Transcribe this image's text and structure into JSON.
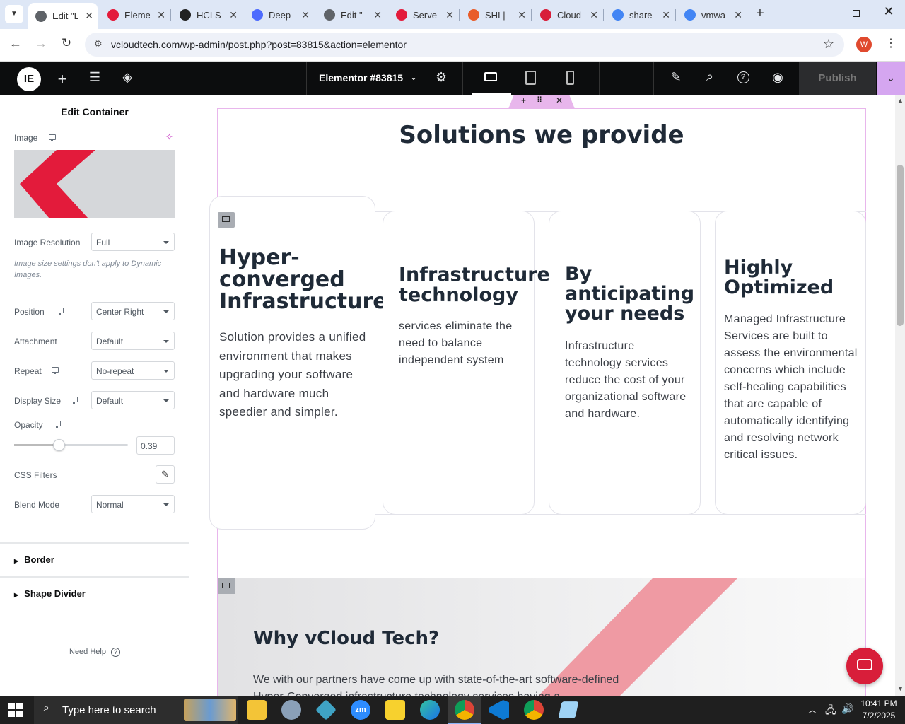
{
  "browser": {
    "tabs": [
      {
        "label": "Edit \"E",
        "active": true,
        "icon": "wordpress-icon"
      },
      {
        "label": "Eleme",
        "icon": "elementor-gem-icon"
      },
      {
        "label": "HCI S",
        "icon": "hci-icon"
      },
      {
        "label": "Deep",
        "icon": "deepseek-icon"
      },
      {
        "label": "Edit \"",
        "icon": "wordpress-icon"
      },
      {
        "label": "Serve",
        "icon": "elementor-gem-icon"
      },
      {
        "label": "SHI |",
        "icon": "shi-icon"
      },
      {
        "label": "Cloud",
        "icon": "cloud-icon"
      },
      {
        "label": "share",
        "icon": "google-icon"
      },
      {
        "label": "vmwa",
        "icon": "google-icon"
      }
    ],
    "url": "vcloudtech.com/wp-admin/post.php?post=83815&action=elementor",
    "profile_initial": "W"
  },
  "editor": {
    "document_title": "Elementor #83815",
    "publish_label": "Publish"
  },
  "panel": {
    "title": "Edit Container",
    "image_label": "Image",
    "image_resolution_label": "Image Resolution",
    "image_resolution_value": "Full",
    "image_note": "Image size settings don't apply to Dynamic Images.",
    "position_label": "Position",
    "position_value": "Center Right",
    "attachment_label": "Attachment",
    "attachment_value": "Default",
    "repeat_label": "Repeat",
    "repeat_value": "No-repeat",
    "display_size_label": "Display Size",
    "display_size_value": "Default",
    "opacity_label": "Opacity",
    "opacity_value": "0.39",
    "opacity_fraction": 0.39,
    "css_filters_label": "CSS Filters",
    "blend_mode_label": "Blend Mode",
    "blend_mode_value": "Normal",
    "border_label": "Border",
    "shape_divider_label": "Shape Divider",
    "need_help_label": "Need Help"
  },
  "page": {
    "section_title": "Solutions we provide",
    "cards": [
      {
        "title": "Hyper-\nconverged\nInfrastructure",
        "text": "Solution provides a unified environment that makes upgrading your software and hardware much speedier and simpler."
      },
      {
        "title": "Infrastructure\ntechnology",
        "text": "services eliminate the need to balance independent system"
      },
      {
        "title": "By\nanticipating\nyour needs",
        "text": "Infrastructure technology services reduce the cost of your organizational software and hardware."
      },
      {
        "title": "Highly\nOptimized",
        "text": "Managed Infrastructure Services are built to assess the environmental concerns which include self-healing capabilities that are capable of automatically identifying and resolving network critical issues."
      }
    ],
    "why_title": "Why vCloud Tech?",
    "why_text": "We with our partners have come up with state-of-the-art software-defined Hyper-Converged infrastructure technology services having a"
  },
  "taskbar": {
    "search_placeholder": "Type here to search",
    "time": "10:41 PM",
    "date": "7/2/2025"
  },
  "colors": {
    "elementor_pink": "#d5a6f0",
    "brand_red": "#e31b3b",
    "editor_dark": "#0c0d0e",
    "chat_red": "#d81e3a"
  }
}
